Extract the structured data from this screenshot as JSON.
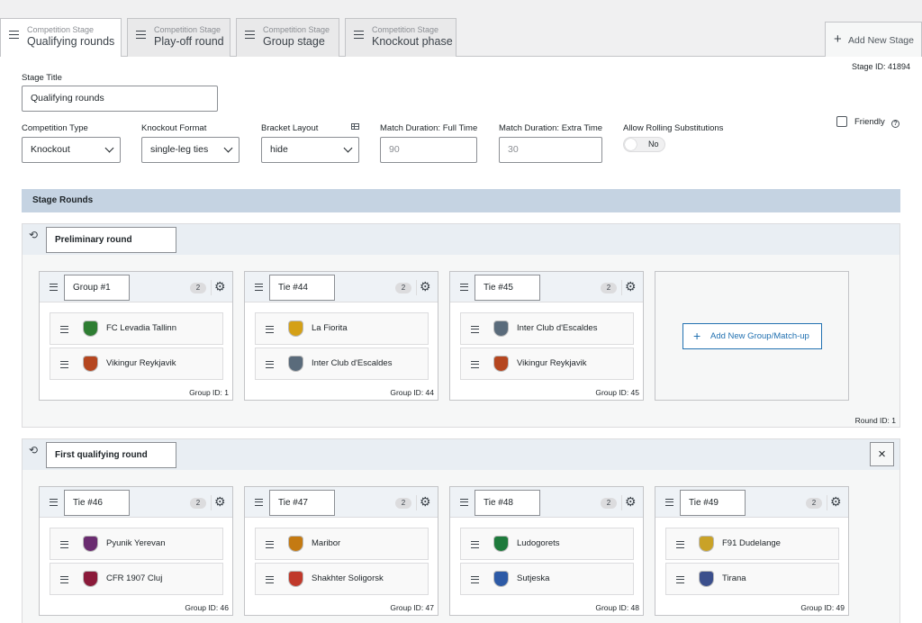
{
  "tabs": [
    {
      "sub": "Competition Stage",
      "title": "Qualifying rounds"
    },
    {
      "sub": "Competition Stage",
      "title": "Play-off round"
    },
    {
      "sub": "Competition Stage",
      "title": "Group stage"
    },
    {
      "sub": "Competition Stage",
      "title": "Knockout phase"
    }
  ],
  "add_stage_label": "Add New Stage",
  "stage_id": "Stage ID: 41894",
  "form": {
    "stage_title_label": "Stage Title",
    "stage_title_value": "Qualifying rounds",
    "competition_type_label": "Competition Type",
    "competition_type_value": "Knockout",
    "knockout_format_label": "Knockout Format",
    "knockout_format_value": "single-leg ties",
    "bracket_layout_label": "Bracket Layout",
    "bracket_layout_value": "hide",
    "full_time_label": "Match Duration: Full Time",
    "full_time_placeholder": "90",
    "extra_time_label": "Match Duration: Extra Time",
    "extra_time_placeholder": "30",
    "rolling_subs_label": "Allow Rolling Substitutions",
    "rolling_subs_value": "No",
    "friendly_label": "Friendly"
  },
  "stage_rounds_header": "Stage Rounds",
  "rounds": [
    {
      "title": "Preliminary round",
      "round_id": "Round ID: 1",
      "groups": [
        {
          "name": "Group #1",
          "count": "2",
          "group_id": "Group ID: 1",
          "teams": [
            {
              "name": "FC Levadia Tallinn",
              "color": "#2e7d32"
            },
            {
              "name": "Vikingur Reykjavik",
              "color": "#b5461f"
            }
          ]
        },
        {
          "name": "Tie #44",
          "count": "2",
          "group_id": "Group ID: 44",
          "teams": [
            {
              "name": "La Fiorita",
              "color": "#d4a017"
            },
            {
              "name": "Inter Club d'Escaldes",
              "color": "#5a6b7b"
            }
          ]
        },
        {
          "name": "Tie #45",
          "count": "2",
          "group_id": "Group ID: 45",
          "teams": [
            {
              "name": "Inter Club d'Escaldes",
              "color": "#5a6b7b"
            },
            {
              "name": "Vikingur Reykjavik",
              "color": "#b5461f"
            }
          ]
        }
      ],
      "add_group_label": "Add New Group/Match-up"
    },
    {
      "title": "First qualifying round",
      "close_label": "×",
      "groups": [
        {
          "name": "Tie #46",
          "count": "2",
          "group_id": "Group ID: 46",
          "teams": [
            {
              "name": "Pyunik Yerevan",
              "color": "#6a2c70"
            },
            {
              "name": "CFR 1907 Cluj",
              "color": "#8b1a3a"
            }
          ]
        },
        {
          "name": "Tie #47",
          "count": "2",
          "group_id": "Group ID: 47",
          "teams": [
            {
              "name": "Maribor",
              "color": "#c47a12"
            },
            {
              "name": "Shakhter Soligorsk",
              "color": "#c0392b"
            }
          ]
        },
        {
          "name": "Tie #48",
          "count": "2",
          "group_id": "Group ID: 48",
          "teams": [
            {
              "name": "Ludogorets",
              "color": "#1e7a3c"
            },
            {
              "name": "Sutjeska",
              "color": "#2d5aa6"
            }
          ]
        },
        {
          "name": "Tie #49",
          "count": "2",
          "group_id": "Group ID: 49",
          "teams": [
            {
              "name": "F91 Dudelange",
              "color": "#c9a227"
            },
            {
              "name": "Tirana",
              "color": "#3b4f8c"
            }
          ]
        }
      ]
    }
  ]
}
